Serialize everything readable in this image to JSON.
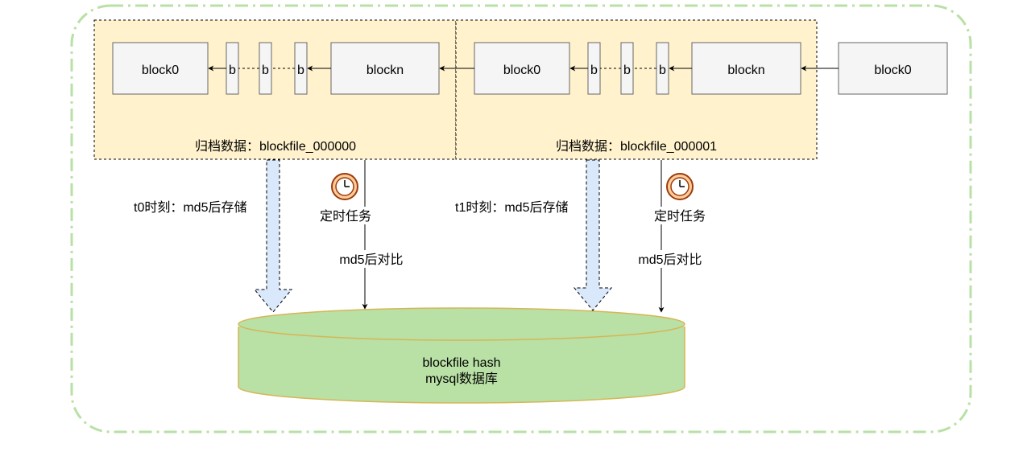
{
  "colors": {
    "outer_border": "#b9e0a5",
    "archive_fill": "#fff2cc",
    "block_fill": "#f5f5f5",
    "block_stroke": "#666666",
    "db_fill": "#b9e0a5",
    "db_stroke": "#d6b656",
    "hash_arrow_fill": "#dae8fc",
    "clock_fill": "#ffcc99",
    "clock_stroke": "#9a3d0e"
  },
  "archives": [
    {
      "caption": "归档数据：blockfile_000000",
      "first_block": "block0",
      "middle_blocks": [
        "b",
        "b",
        "b"
      ],
      "last_block": "blockn"
    },
    {
      "caption": "归档数据：blockfile_000001",
      "first_block": "block0",
      "middle_blocks": [
        "b",
        "b",
        "b"
      ],
      "last_block": "blockn"
    }
  ],
  "incoming_block": "block0",
  "flows": [
    {
      "store_label": "t0时刻：md5后存储",
      "task_label": "定时任务",
      "compare_label": "md5后对比"
    },
    {
      "store_label": "t1时刻：md5后存储",
      "task_label": "定时任务",
      "compare_label": "md5后对比"
    }
  ],
  "database": {
    "line1": "blockfile hash",
    "line2": "mysql数据库"
  }
}
